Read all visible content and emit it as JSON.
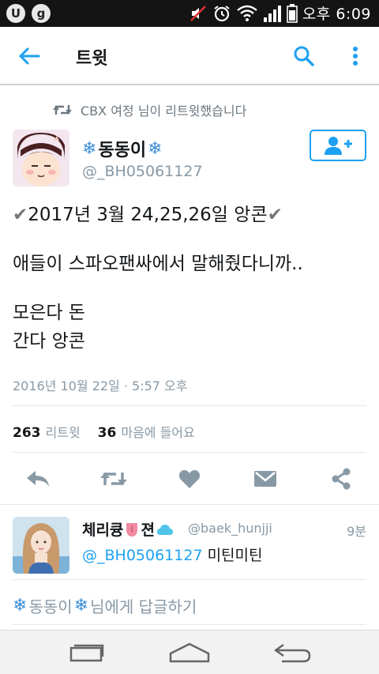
{
  "status_bar": {
    "left_icons": [
      "U",
      "g"
    ],
    "time": "오후 6:09"
  },
  "app_bar": {
    "title": "트윗",
    "back_icon": "arrow-left-icon",
    "search_icon": "search-icon",
    "more_icon": "more-vertical-icon",
    "accent_color": "#1da1f2"
  },
  "retweet_context": {
    "text": "CBX 여정 님이 리트윗했습니다"
  },
  "author": {
    "snowflake": "❄",
    "name": "동동이",
    "handle": "@_BH05061127"
  },
  "tweet": {
    "check": "✔",
    "line1": "2017년 3월 24,25,26일 앙콘",
    "line2": "애들이 스파오팬싸에서 말해줬다니까..",
    "line3": "모은다 돈",
    "line4": "간다 앙콘",
    "timestamp": "2016년 10월 22일 · 5:57 오후"
  },
  "stats": {
    "retweets_count": "263",
    "retweets_label": "리트윗",
    "likes_count": "36",
    "likes_label": "마음에 들어요"
  },
  "reply": {
    "name": "체리큥",
    "name_suffix": "젼",
    "handle": "@baek_hunjji",
    "time": "9분",
    "mention": "@_BH05061127",
    "text": "미틴미틴"
  },
  "compose": {
    "name": "동동이",
    "suffix": "님에게 답글하기"
  }
}
